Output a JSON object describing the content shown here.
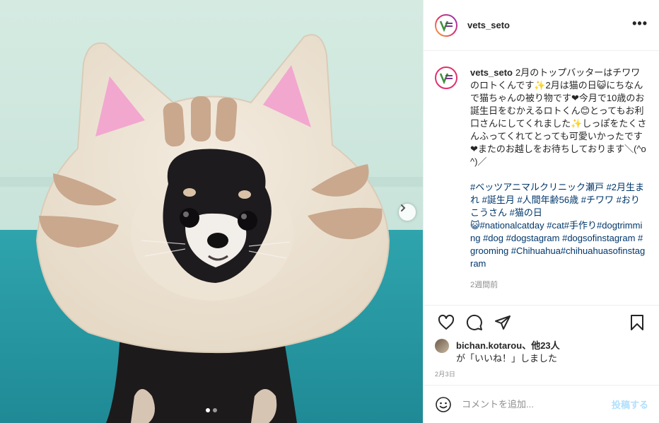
{
  "post": {
    "username": "vets_seto",
    "more_icon": "more-horizontal-icon",
    "caption": "2月のトップバッターはチワワのロトくんです✨2月は猫の日😺にちなんで猫ちゃんの被り物です❤今月で10歳のお誕生日をむかえるロトくん😊とってもお利口さんにしてくれました✨しっぽをたくさんふってくれてとっても可愛いかったです❤またのお越しをお待ちしております＼(^o^)／",
    "hashtags_1": "#ベッツアニマルクリニック瀬戸 #2月生まれ #誕生月 #人間年齢56歳 #チワワ #おりこうさん #猫の日",
    "hashtags_2": "😺#nationalcatday #cat#手作り#dogtrimming #dog #dogstagram #dogsofinstagram #grooming #Chihuahua#chihuahuasofinstagram",
    "time_ago": "2週間前",
    "likes_user": "bichan.kotarou",
    "likes_others": "、他23人",
    "likes_suffix": "が「いいね！」しました",
    "date": "2月3日",
    "comment_placeholder": "コメントを追加...",
    "post_label": "投稿する"
  },
  "carousel": {
    "current": 1,
    "total": 2
  },
  "colors": {
    "link": "#00376b",
    "post_button": "#b2dffc",
    "felt_beige": "#eee4d4",
    "felt_stripe": "#c9a88e",
    "ear_pink": "#f2a7cf",
    "mat_teal": "#2f9fa8"
  }
}
